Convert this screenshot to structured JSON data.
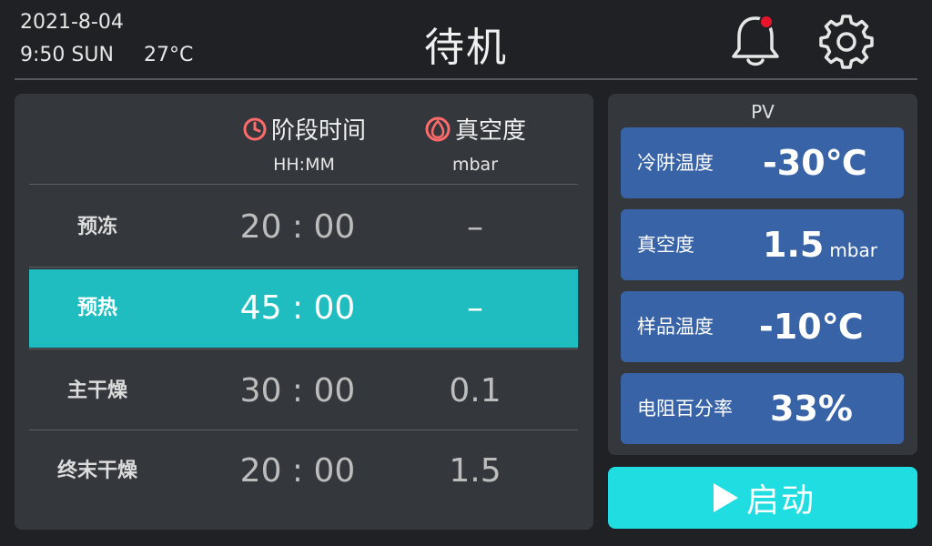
{
  "header": {
    "date": "2021-8-04",
    "time": "9:50 SUN",
    "temperature": "27°C",
    "title": "待机",
    "alert_dot_color": "#e8142c"
  },
  "table": {
    "time_header": "阶段时间",
    "time_unit": "HH:MM",
    "vacuum_header": "真空度",
    "vacuum_unit": "mbar",
    "icon_color": "#ff6b6b",
    "rows": [
      {
        "name": "预冻",
        "time": "20 : 00",
        "vacuum": "–",
        "active": false
      },
      {
        "name": "预热",
        "time": "45 : 00",
        "vacuum": "–",
        "active": true
      },
      {
        "name": "主干燥",
        "time": "30 : 00",
        "vacuum": "0.1",
        "active": false
      },
      {
        "name": "终末干燥",
        "time": "20 : 00",
        "vacuum": "1.5",
        "active": false
      }
    ]
  },
  "pv": {
    "title": "PV",
    "items": [
      {
        "label": "冷阱温度",
        "value": "-30℃",
        "unit": ""
      },
      {
        "label": "真空度",
        "value": "1.5",
        "unit": "mbar"
      },
      {
        "label": "样品温度",
        "value": "-10℃",
        "unit": ""
      },
      {
        "label": "电阻百分率",
        "value": "33%",
        "unit": ""
      }
    ]
  },
  "start_button": {
    "label": "启动",
    "color": "#1fdde1"
  },
  "colors": {
    "accent_teal": "#1fbdbf",
    "pv_card": "#3863a6",
    "panel": "#34373c",
    "background": "#1f2125"
  }
}
